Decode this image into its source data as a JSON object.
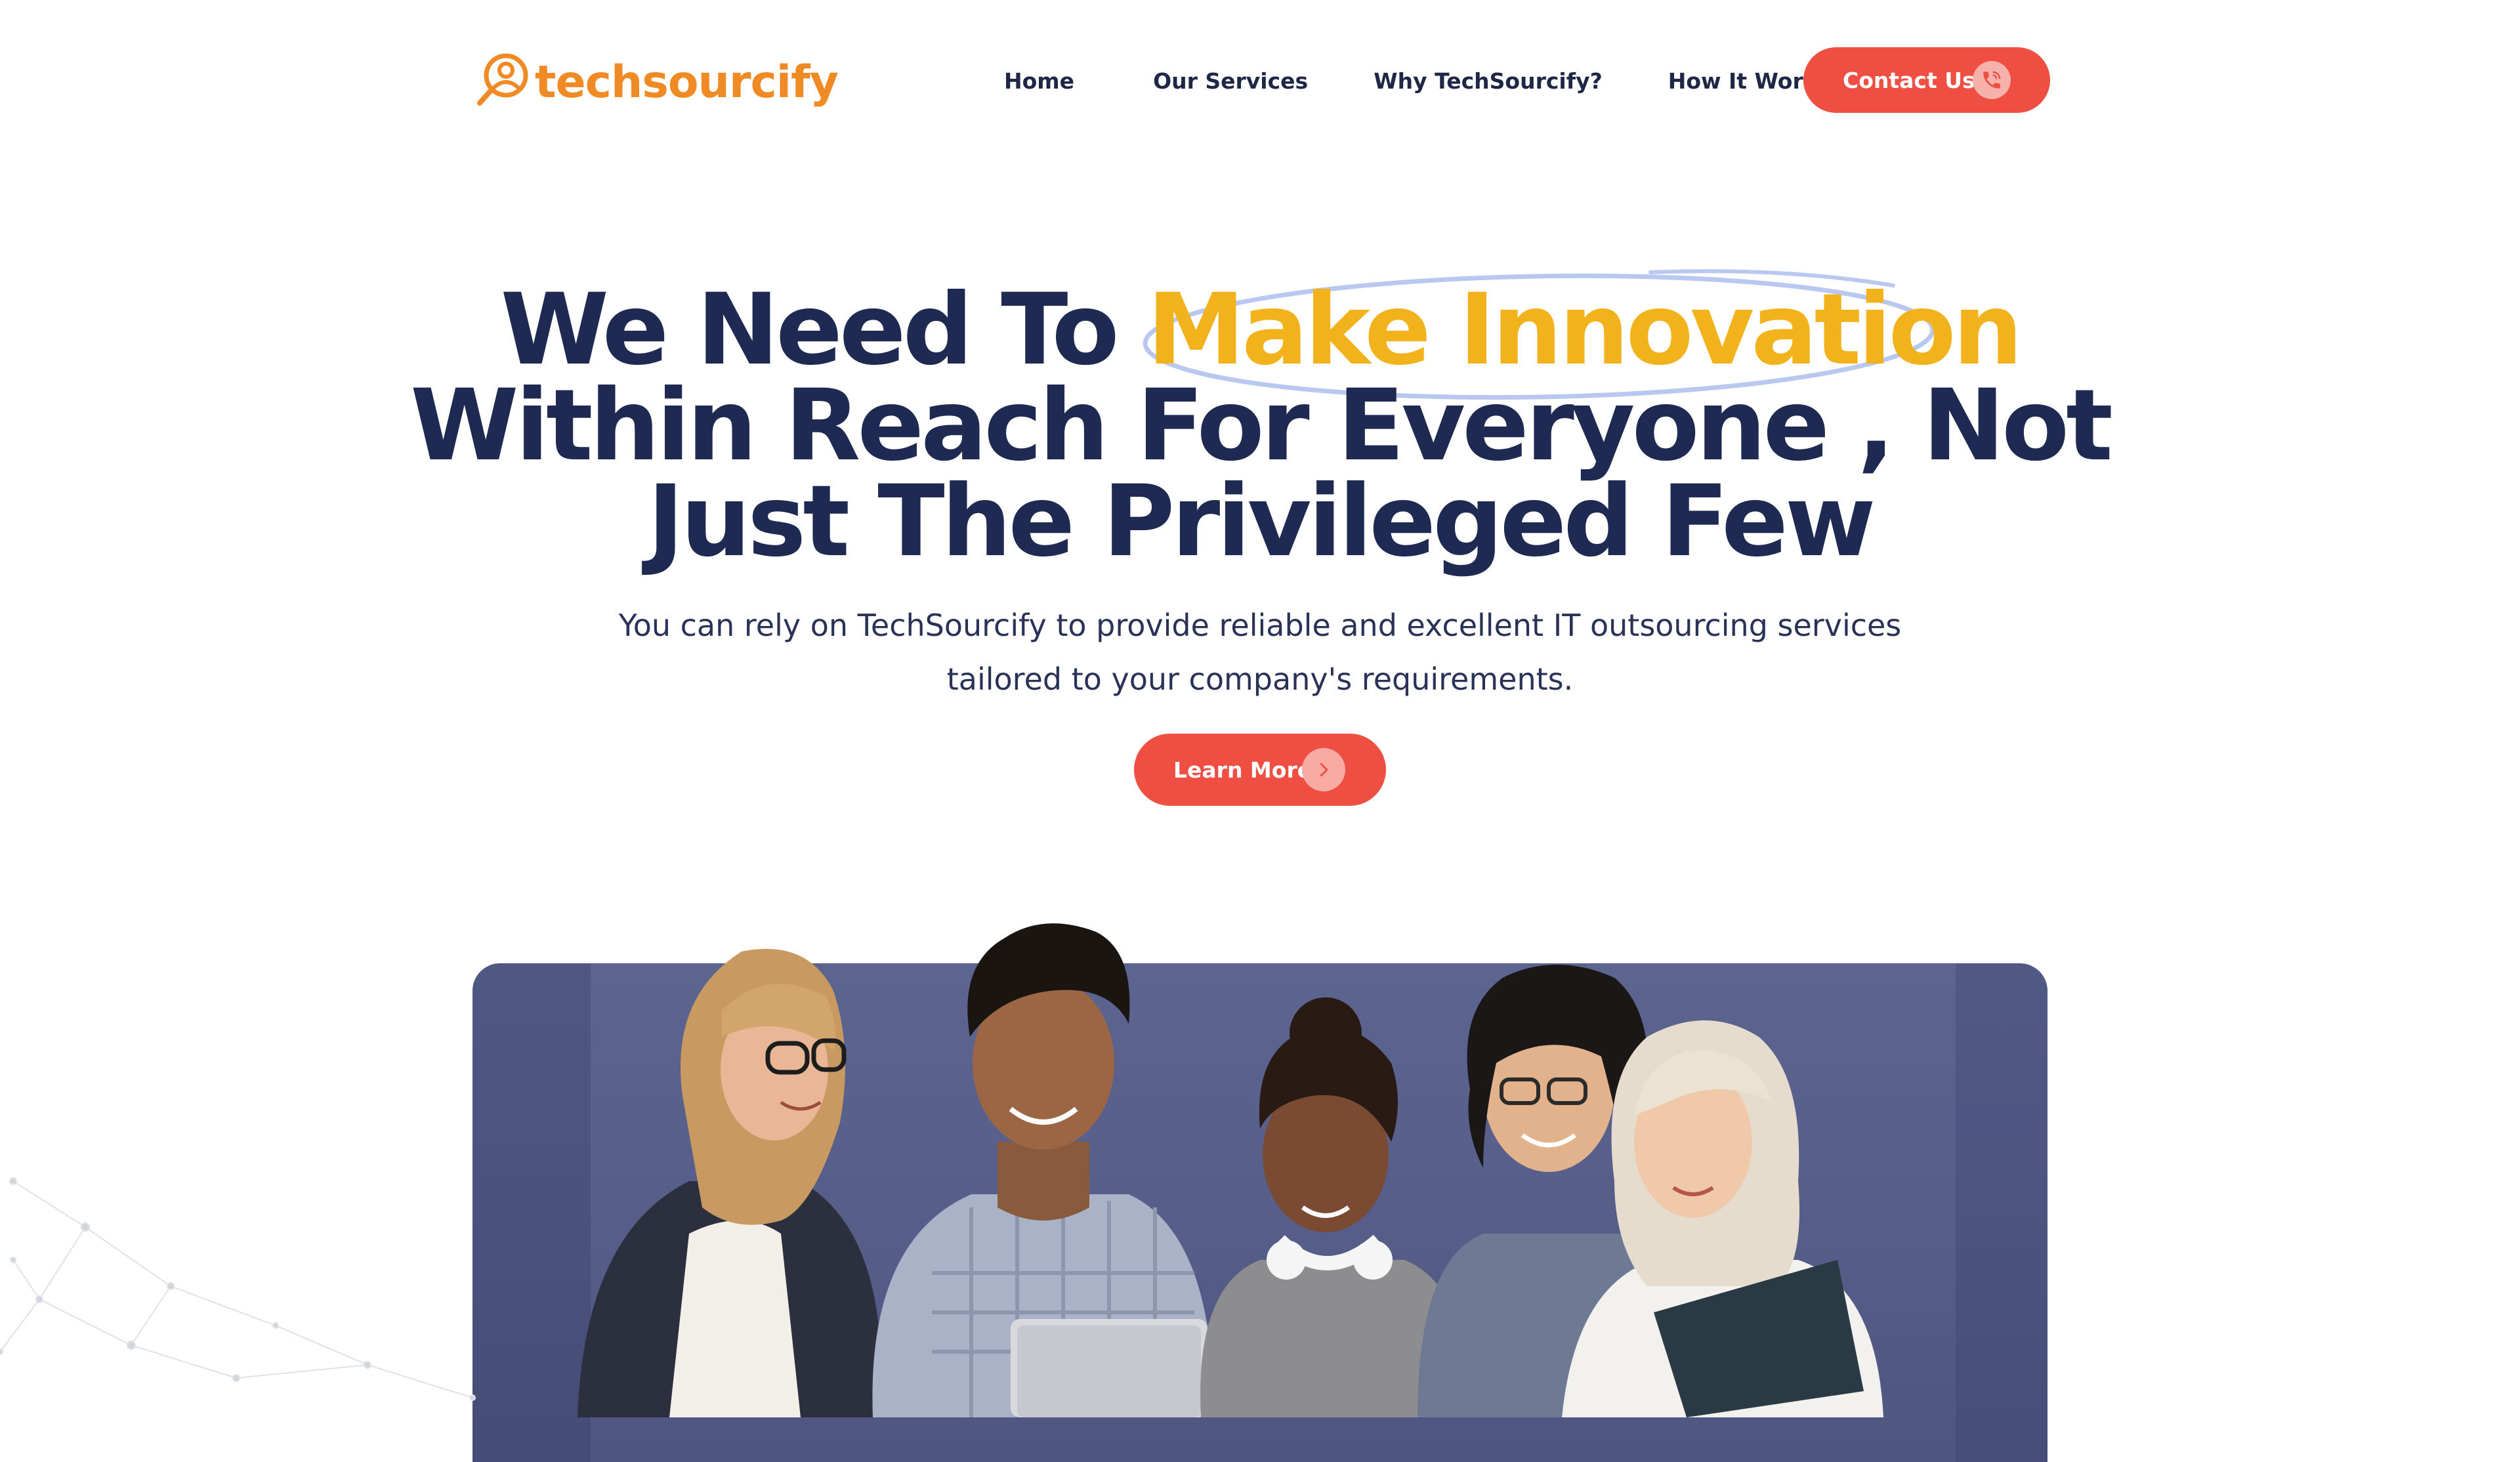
{
  "header": {
    "logo_text": "techsourcify",
    "nav": [
      "Home",
      "Our Services",
      "Why TechSourcify?",
      "How It Works"
    ],
    "contact_label": "Contact Us",
    "contact_icon": "phone-icon"
  },
  "hero": {
    "title_line1_a": "We Need To ",
    "title_line1_b": "Make Innovation",
    "title_line2": "Within Reach For Everyone , Not",
    "title_line3": "Just The Privileged Few",
    "subtitle_line1": "You can rely on TechSourcify to provide reliable and excellent IT outsourcing services",
    "subtitle_line2": "tailored to your company's requirements.",
    "cta_label": "Learn More",
    "cta_icon": "chevron-right-icon"
  },
  "colors": {
    "brand_orange": "#f08a24",
    "accent_red": "#ef4e43",
    "highlight_yellow": "#f2b21b",
    "heading_navy": "#1e2a52",
    "photo_bg": "#5c6490"
  }
}
